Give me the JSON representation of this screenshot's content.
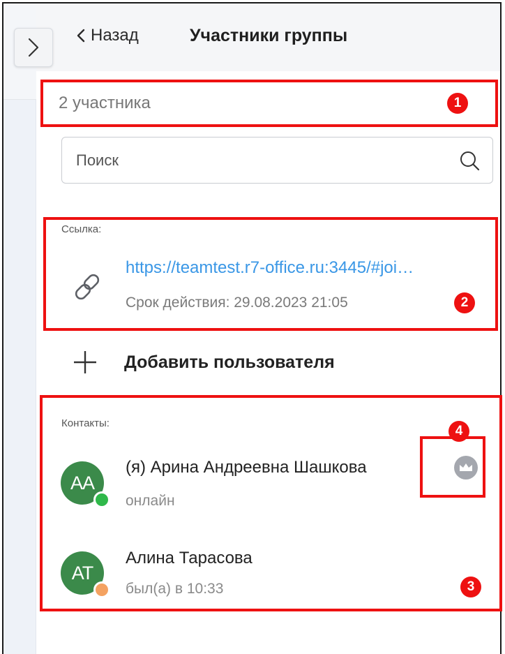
{
  "header": {
    "back_label": "Назад",
    "title": "Участники группы"
  },
  "members_count": "2 участника",
  "search": {
    "placeholder": "Поиск",
    "value": ""
  },
  "link_section": {
    "label": "Ссылка:",
    "url": "https://teamtest.r7-office.ru:3445/#joi…",
    "expiry": "Срок действия: 29.08.2023 21:05"
  },
  "add_user_label": "Добавить пользователя",
  "contacts": {
    "label": "Контакты:",
    "items": [
      {
        "initials": "AA",
        "name": "(я) Арина Андреевна Шашкова",
        "status": "онлайн",
        "status_color": "#2fb84a",
        "role_icon": "crown-icon"
      },
      {
        "initials": "AT",
        "name": "Алина Тарасова",
        "status": "был(а) в 10:33",
        "status_color": "#f4a261"
      }
    ]
  },
  "annotations": [
    "1",
    "2",
    "3",
    "4"
  ],
  "colors": {
    "accent_link": "#3a97e6",
    "avatar_bg": "#3b8a4a",
    "annotation_red": "#ee1111"
  }
}
